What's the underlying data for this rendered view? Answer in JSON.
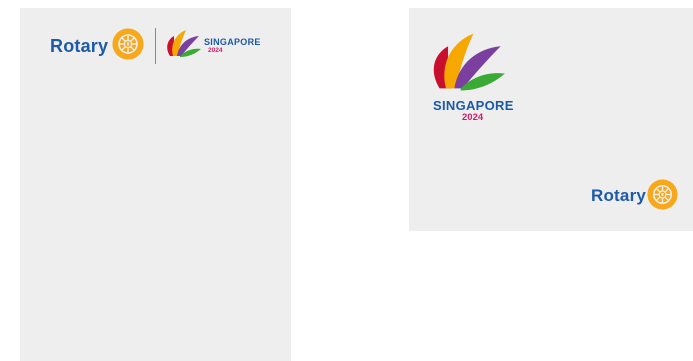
{
  "header_logo": {
    "rotary": "Rotary",
    "city": "SINGAPORE",
    "year": "2024"
  },
  "convention_logo": {
    "city": "SINGAPORE",
    "year": "2024",
    "rotary": "Rotary"
  },
  "colors": {
    "card_background": "#eeeeee",
    "rotary_blue": "#1e5aa8",
    "rotary_gold": "#f7a81b",
    "singapore_blue": "#1a5aa6",
    "year_magenta": "#d01c6a"
  },
  "icons": [
    "rotary-wheel-icon",
    "singapore-petals-icon"
  ]
}
